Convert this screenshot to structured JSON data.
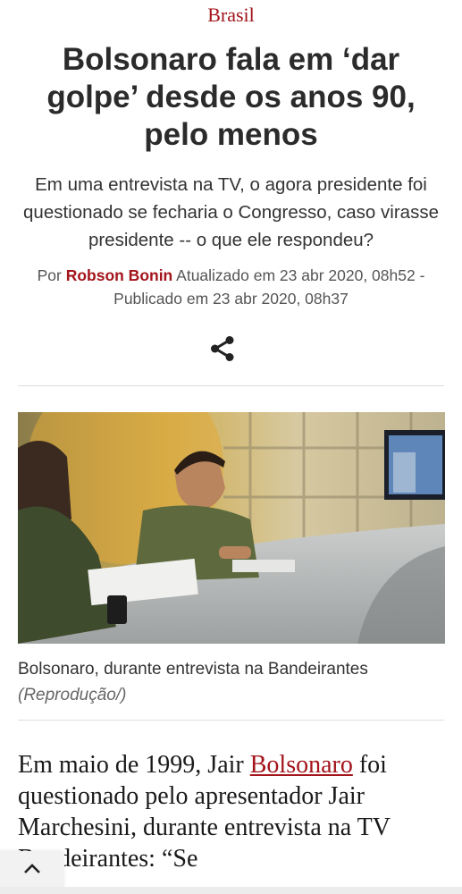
{
  "article": {
    "section": "Brasil",
    "headline": "Bolsonaro fala em ‘dar golpe’ desde os anos 90, pelo menos",
    "subtitle": "Em uma entrevista na TV, o agora presidente foi questionado se fecharia o Congresso, caso virasse presidente -- o que ele respondeu?",
    "byline": {
      "prefix": "Por",
      "author": "Robson Bonin",
      "updated": "Atualizado em 23 abr 2020, 08h52 -",
      "published": "Publicado em 23 abr 2020, 08h37"
    },
    "share_icon": "share-icon",
    "image": {
      "caption": "Bolsonaro, durante entrevista na Bandeirantes",
      "credit": "(Reprodução/)"
    },
    "body": {
      "text_before_link": "Em maio de 1999, Jair ",
      "link_text": "Bolsonaro",
      "text_after_link": " foi questionado pelo apresentador Jair Marchesini, durante entrevista na TV Bandeirantes: “Se"
    }
  },
  "ui": {
    "back_to_top_icon": "chevron-up-icon"
  },
  "colors": {
    "accent": "#a3141b",
    "headline": "#2b2b2b",
    "rule": "#dddddd"
  }
}
